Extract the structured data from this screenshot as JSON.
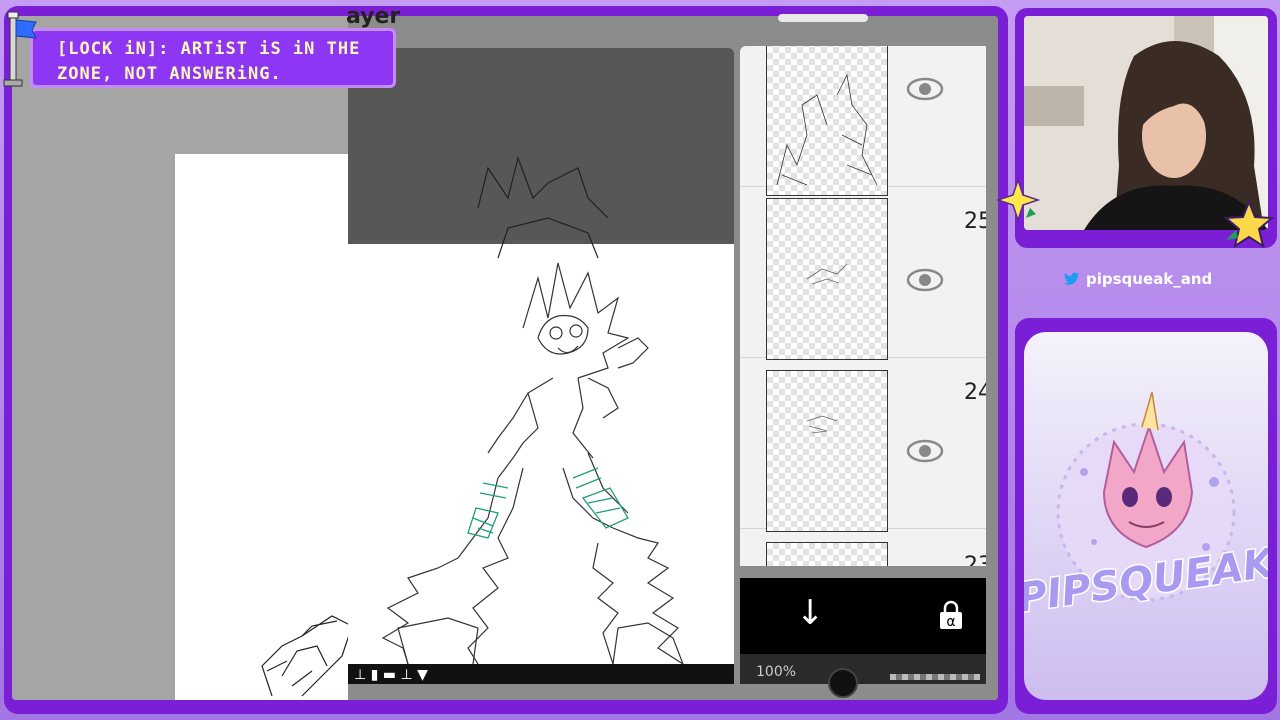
{
  "banner": {
    "text_line1": "[LOCK iN]: ARTiST iS iN THE",
    "text_line2": "ZONE, NOT ANSWERiNG."
  },
  "app": {
    "panel_title": "ayer",
    "preview_bottom_glyphs": "⊥ ▮ ▬ ⊥ ▼"
  },
  "layers": [
    {
      "number": "",
      "visible": true
    },
    {
      "number": "25",
      "visible": true
    },
    {
      "number": "24",
      "visible": true
    },
    {
      "number": "23",
      "visible": true
    }
  ],
  "actions": {
    "merge_down_glyph": "↓",
    "opacity_label": "100%"
  },
  "social": {
    "platform_icon": "twitter-icon",
    "handle": "pipsqueak_and"
  },
  "logo": {
    "text": "PIPSQUEAK"
  },
  "colors": {
    "frame_purple": "#7a1fd6",
    "banner_text": "#fff7b8",
    "stocking_green": "#1f9e78"
  }
}
